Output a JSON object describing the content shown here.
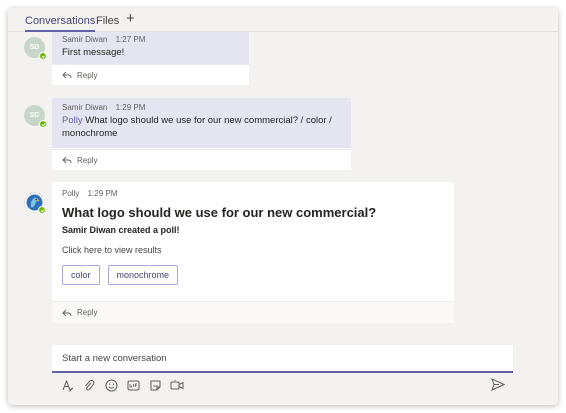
{
  "tabs": [
    {
      "label": "Conversations",
      "active": true
    },
    {
      "label": "Files",
      "active": false
    }
  ],
  "add_tab_glyph": "+",
  "messages": [
    {
      "avatar": "SD",
      "author": "Samir Diwan",
      "time": "1:27 PM",
      "text": "First message!",
      "reply": "Reply"
    },
    {
      "avatar": "SD",
      "author": "Samir Diwan",
      "time": "1:29 PM",
      "mention": "Polly",
      "text": " What logo should we use for our new commercial? / color / monochrome",
      "reply": "Reply"
    }
  ],
  "poll": {
    "author": "Polly",
    "time": "1:29 PM",
    "title": "What logo should we use for our new commercial?",
    "subtitle": "Samir Diwan created a poll!",
    "link": "Click here to view results",
    "options": [
      "color",
      "monochrome"
    ],
    "reply": "Reply"
  },
  "compose": {
    "placeholder": "Start a new conversation"
  },
  "toolbar": {
    "icons": [
      "format-icon",
      "attach-icon",
      "emoji-icon",
      "gif-icon",
      "sticker-icon",
      "meet-icon"
    ]
  },
  "colors": {
    "accent": "#6264a7",
    "highlight": "#e5e5f1",
    "presence": "#6bb700"
  }
}
